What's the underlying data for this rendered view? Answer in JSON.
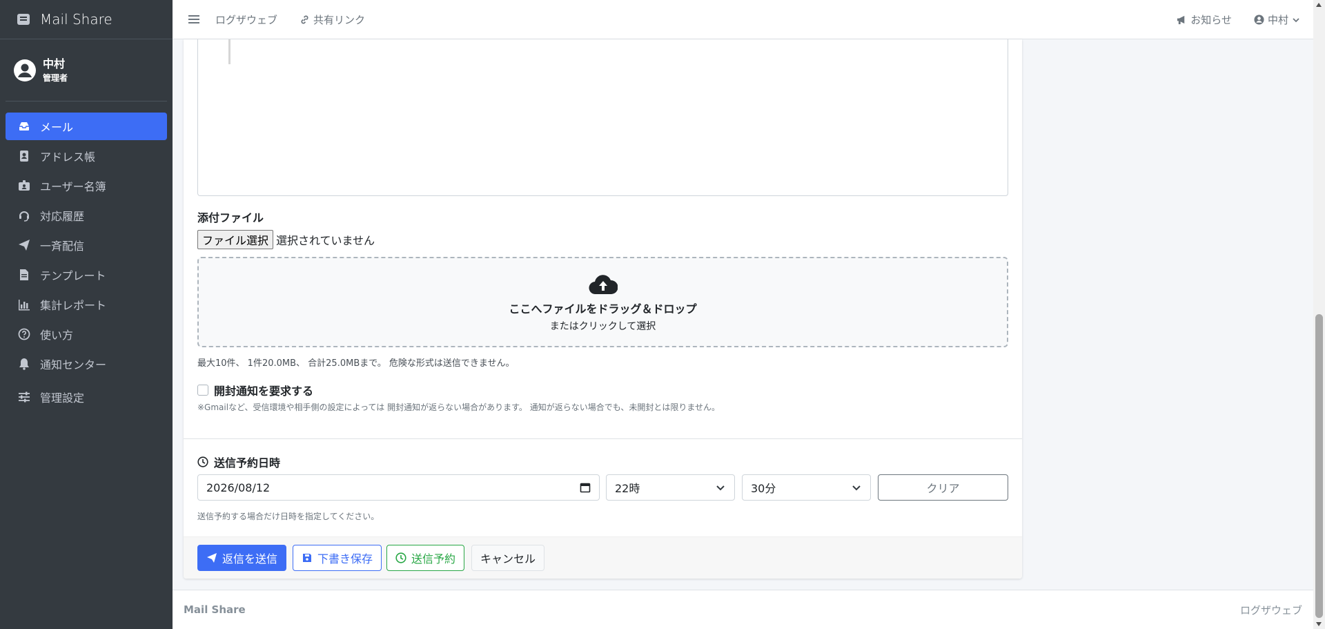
{
  "app": {
    "brand": "Mail Share"
  },
  "user": {
    "name": "中村",
    "role": "管理者"
  },
  "sidebar": {
    "items": [
      {
        "label": "メール"
      },
      {
        "label": "アドレス帳"
      },
      {
        "label": "ユーザー名簿"
      },
      {
        "label": "対応履歴"
      },
      {
        "label": "一斉配信"
      },
      {
        "label": "テンプレート"
      },
      {
        "label": "集計レポート"
      },
      {
        "label": "使い方"
      },
      {
        "label": "通知センター"
      },
      {
        "label": "管理設定"
      }
    ]
  },
  "topbar": {
    "link1": "ログザウェブ",
    "link2": "共有リンク",
    "notices": "お知らせ",
    "user": "中村"
  },
  "attachments": {
    "label": "添付ファイル",
    "file_button": "ファイル選択",
    "file_status": "選択されていません",
    "drop_title": "ここへファイルをドラッグ＆ドロップ",
    "drop_sub": "またはクリックして選択",
    "limits": "最大10件、 1件20.0MB、 合計25.0MBまで。 危険な形式は送信できません。"
  },
  "read_receipt": {
    "label": "開封通知を要求する",
    "note": "※Gmailなど、受信環境や相手側の設定によっては 開封通知が返らない場合があります。 通知が返らない場合でも、未開封とは限りません。"
  },
  "schedule": {
    "title": "送信予約日時",
    "date": "2026/08/12",
    "hour": "22時",
    "minute": "30分",
    "clear": "クリア",
    "help": "送信予約する場合だけ日時を指定してください。"
  },
  "actions": {
    "send": "返信を送信",
    "draft": "下書き保存",
    "schedule": "送信予約",
    "cancel": "キャンセル"
  },
  "footer": {
    "left": "Mail Share",
    "right": "ログザウェブ"
  }
}
